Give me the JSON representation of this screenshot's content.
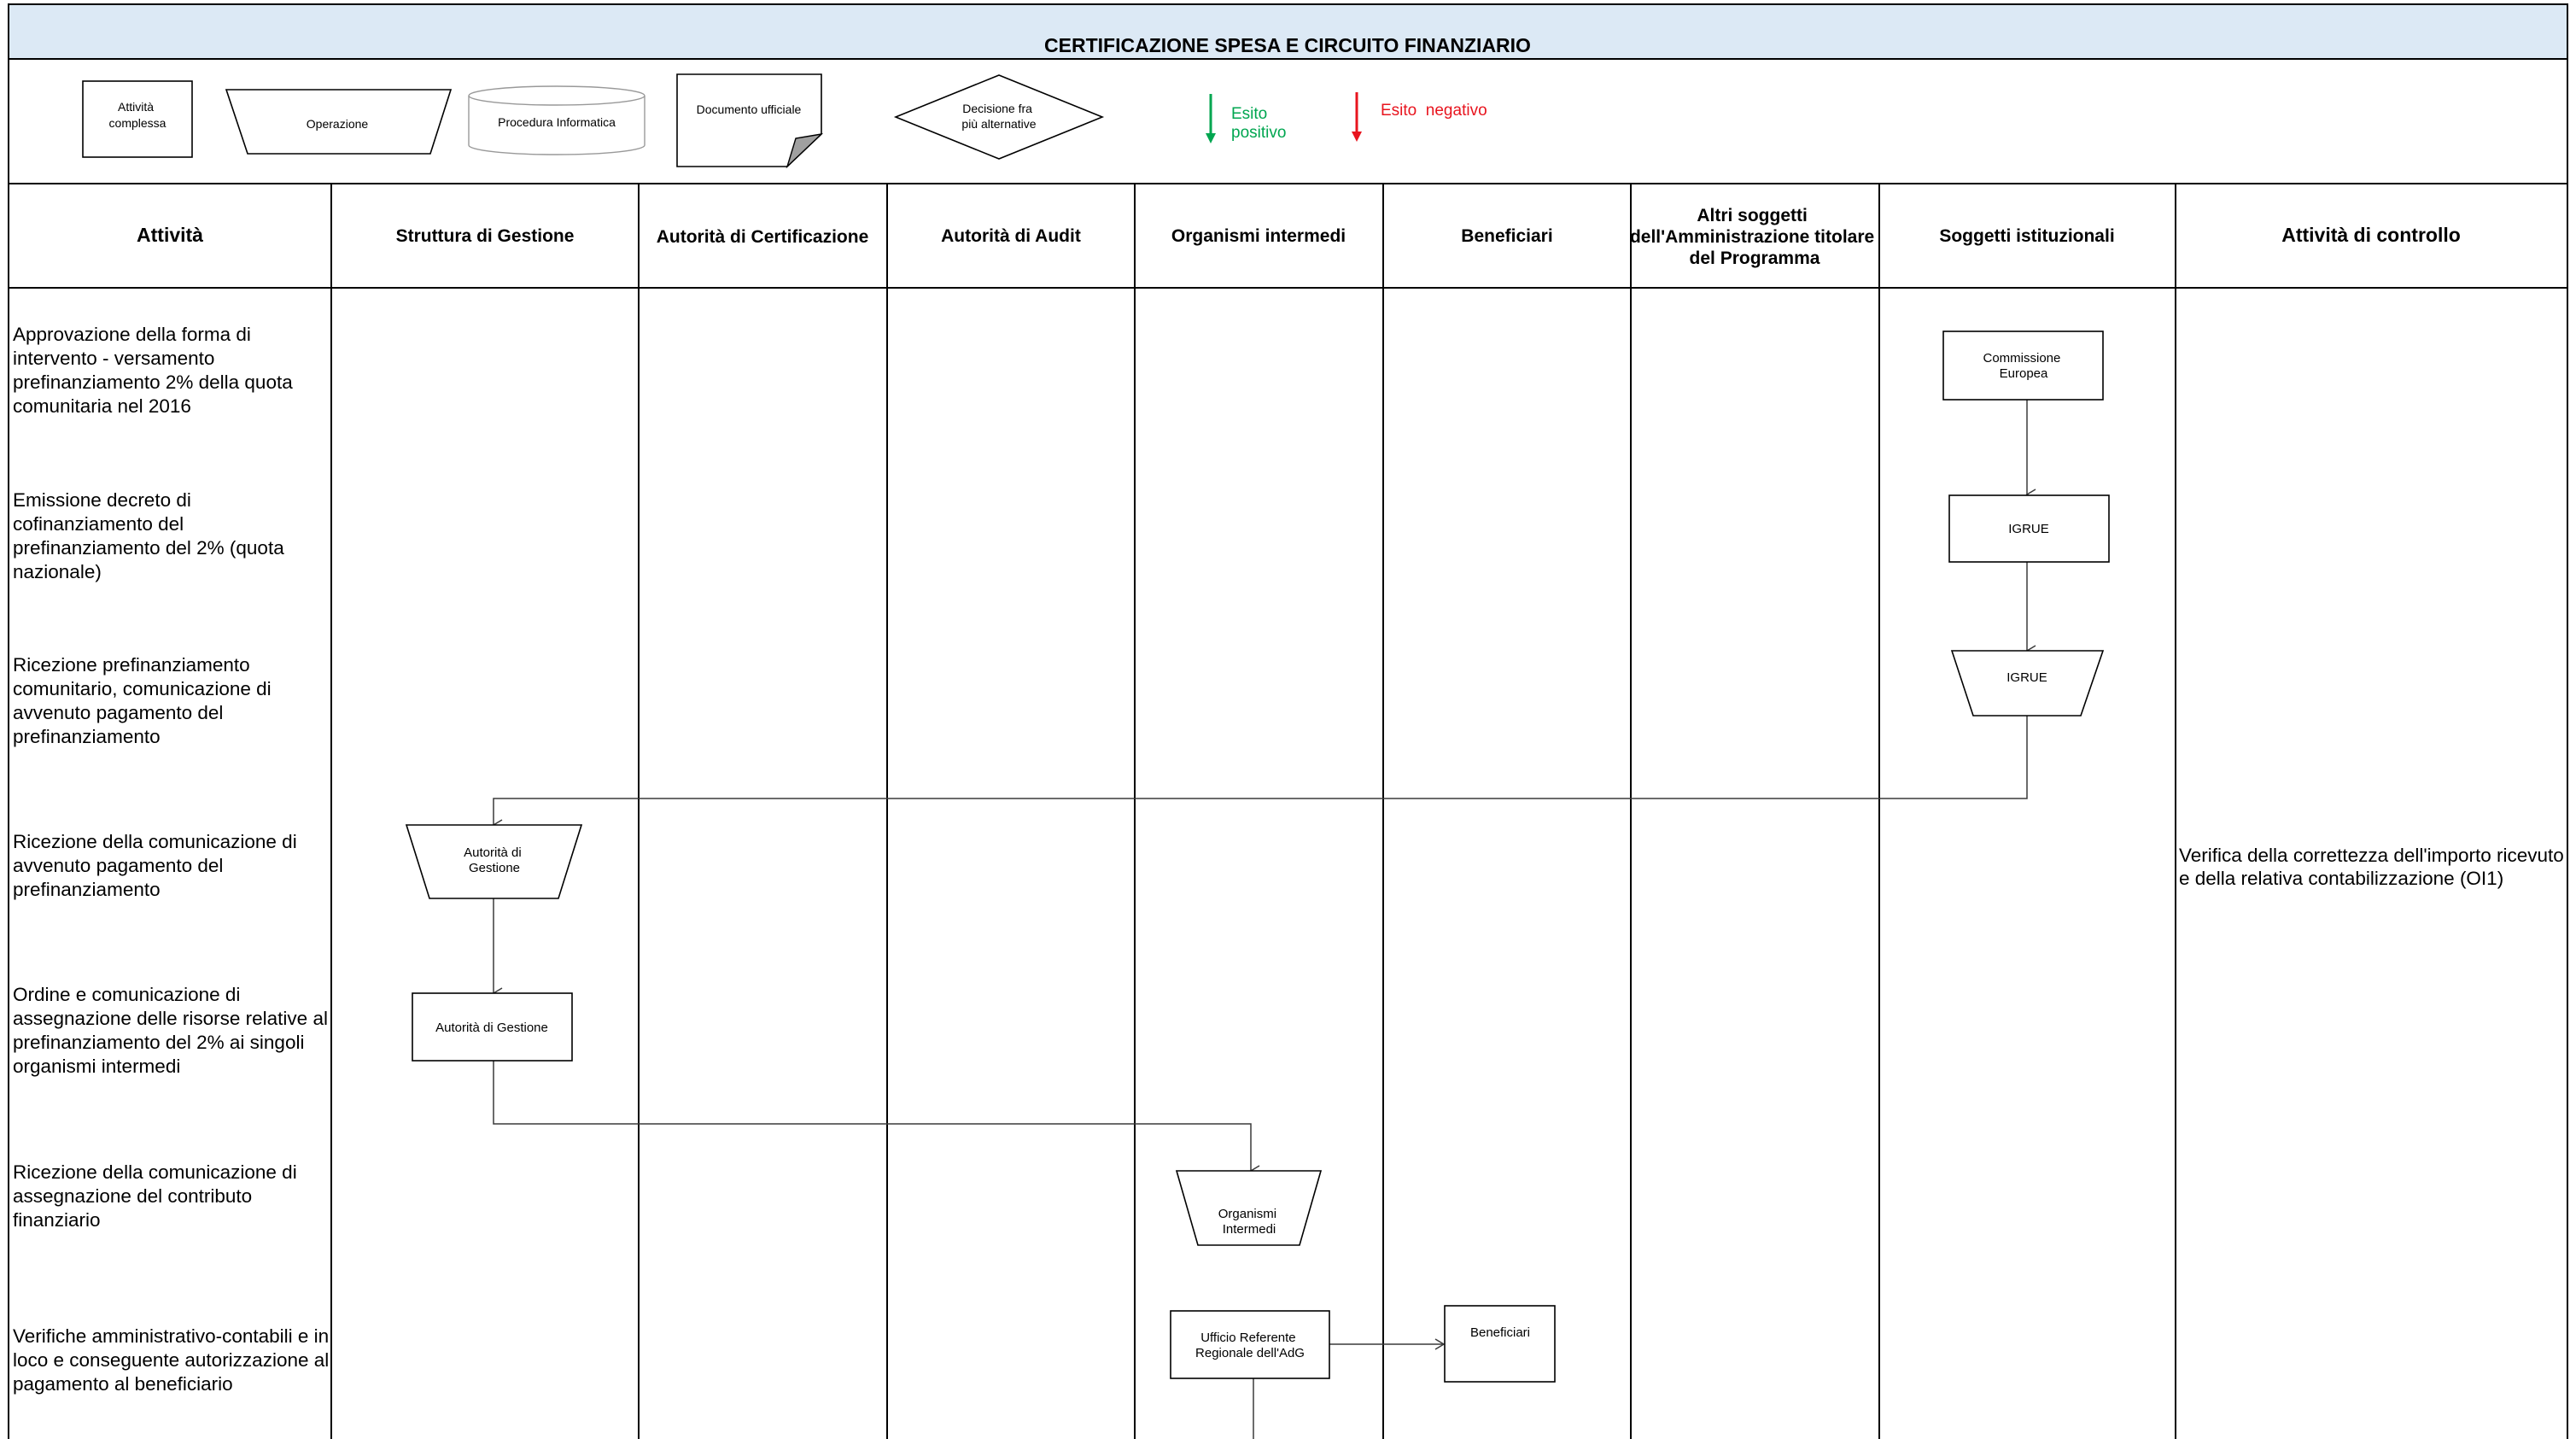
{
  "title": "CERTIFICAZIONE SPESA E CIRCUITO FINANZIARIO",
  "legend": {
    "complex_activity": [
      "Attività",
      "complessa"
    ],
    "operation": "Operazione",
    "it_procedure": "Procedura Informatica",
    "official_document": "Documento ufficiale",
    "decision": [
      "Decisione fra",
      "più alternative"
    ],
    "positive": [
      "Esito",
      "positivo"
    ],
    "negative": "Esito  negativo",
    "positive_color": "#00a650",
    "negative_color": "#e8141e"
  },
  "columns": [
    {
      "label": [
        "Attività"
      ]
    },
    {
      "label": [
        "Struttura di Gestione"
      ]
    },
    {
      "label": [
        "Autorità di Certificazione"
      ]
    },
    {
      "label": [
        "Autorità di Audit"
      ]
    },
    {
      "label": [
        "Organismi intermedi"
      ]
    },
    {
      "label": [
        "Beneficiari"
      ]
    },
    {
      "label": [
        "Altri soggetti",
        "dell'Amministrazione titolare",
        "del Programma"
      ]
    },
    {
      "label": [
        "Soggetti istituzionali"
      ]
    },
    {
      "label": [
        "Attività di controllo"
      ]
    }
  ],
  "activities": [
    [
      "Approvazione della forma di",
      "intervento - versamento",
      "prefinanziamento 2% della quota",
      "comunitaria nel 2016"
    ],
    [
      "Emissione decreto di",
      "cofinanziamento del",
      "prefinanziamento del 2% (quota",
      "nazionale)"
    ],
    [
      "Ricezione prefinanziamento",
      "comunitario, comunicazione di",
      "avvenuto pagamento del",
      "prefinanziamento"
    ],
    [
      "Ricezione della comunicazione di",
      "avvenuto pagamento del",
      "prefinanziamento"
    ],
    [
      "Ordine e comunicazione di",
      "assegnazione delle risorse relative al",
      "prefinanziamento del 2% ai singoli",
      "organismi intermedi"
    ],
    [
      "Ricezione della comunicazione di",
      "assegnazione del contributo",
      "finanziario"
    ],
    [
      "Verifiche amministrativo-contabili e in",
      "loco e conseguente autorizzazione al",
      "pagamento al beneficiario"
    ]
  ],
  "controls": [
    "Verifica della correttezza dell'importo ricevuto",
    "e della relativa contabilizzazione (OI1)"
  ],
  "nodes": {
    "commissione": [
      "Commissione",
      "Europea"
    ],
    "igrue_rect": [
      "IGRUE"
    ],
    "igrue_op": [
      "IGRUE"
    ],
    "adg_op": [
      "Autorità di",
      "Gestione"
    ],
    "adg_rect": [
      "Autorità di Gestione"
    ],
    "oi_op": [
      "Organismi",
      "Intermedi"
    ],
    "ufficio": [
      "Ufficio Referente",
      "Regionale dell'AdG"
    ],
    "beneficiari": [
      "Beneficiari"
    ]
  }
}
